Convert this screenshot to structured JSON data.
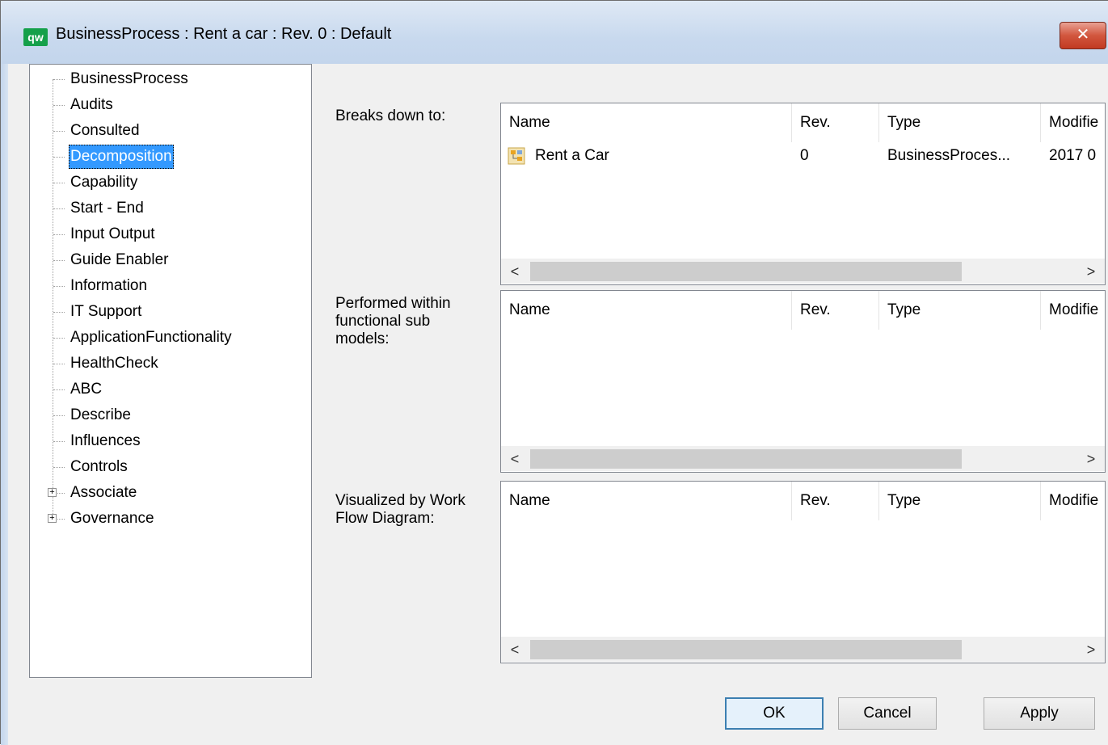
{
  "window": {
    "icon_text": "qw",
    "title": "BusinessProcess : Rent a car : Rev. 0  : Default",
    "close_symbol": "✕"
  },
  "tree": {
    "items": [
      {
        "label": "BusinessProcess",
        "expandable": false
      },
      {
        "label": "Audits",
        "expandable": false
      },
      {
        "label": "Consulted",
        "expandable": false
      },
      {
        "label": "Decomposition",
        "expandable": false,
        "selected": true
      },
      {
        "label": "Capability",
        "expandable": false
      },
      {
        "label": "Start - End",
        "expandable": false
      },
      {
        "label": "Input Output",
        "expandable": false
      },
      {
        "label": "Guide Enabler",
        "expandable": false
      },
      {
        "label": "Information",
        "expandable": false
      },
      {
        "label": "IT Support",
        "expandable": false
      },
      {
        "label": "ApplicationFunctionality",
        "expandable": false
      },
      {
        "label": "HealthCheck",
        "expandable": false
      },
      {
        "label": "ABC",
        "expandable": false
      },
      {
        "label": "Describe",
        "expandable": false
      },
      {
        "label": "Influences",
        "expandable": false
      },
      {
        "label": "Controls",
        "expandable": false
      },
      {
        "label": "Associate",
        "expandable": true
      },
      {
        "label": "Governance",
        "expandable": true
      }
    ],
    "expander_symbol": "+"
  },
  "sections": [
    {
      "label": "Breaks down to:",
      "columns": [
        "Name",
        "Rev.",
        "Type",
        "Modifie"
      ],
      "rows": [
        {
          "icon": "business-process-icon",
          "name": "Rent a Car",
          "rev": "0",
          "type": "BusinessProces...",
          "modified": "2017 0"
        }
      ]
    },
    {
      "label": "Performed within functional sub models:",
      "columns": [
        "Name",
        "Rev.",
        "Type",
        "Modifie"
      ],
      "rows": []
    },
    {
      "label": "Visualized by Work Flow Diagram:",
      "columns": [
        "Name",
        "Rev.",
        "Type",
        "Modifie"
      ],
      "rows": []
    }
  ],
  "scroll": {
    "left": "<",
    "right": ">"
  },
  "buttons": {
    "ok": "OK",
    "cancel": "Cancel",
    "apply": "Apply"
  }
}
